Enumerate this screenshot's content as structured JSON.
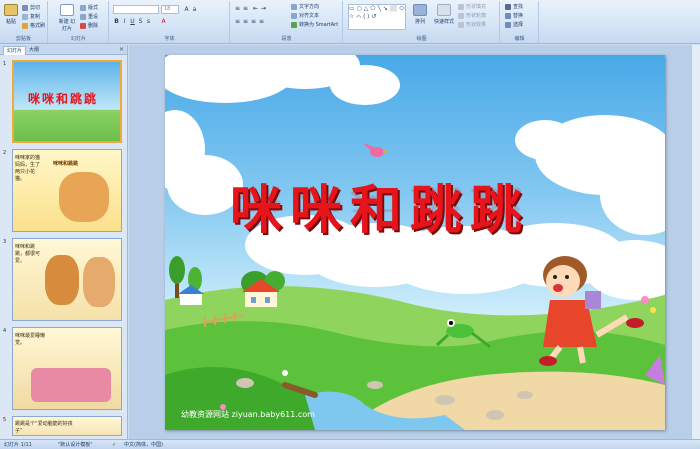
{
  "ribbon": {
    "groups": [
      "剪贴板",
      "幻灯片",
      "字体",
      "段落",
      "绘图",
      "编辑"
    ],
    "clipboard": {
      "paste": "粘贴",
      "cut": "剪切",
      "copy": "复制",
      "format_painter": "格式刷"
    },
    "slides": {
      "new_slide": "新建\n幻灯片",
      "layout": "版式",
      "reset": "重设",
      "delete": "删除"
    },
    "font": {
      "name": "",
      "size": "18"
    },
    "paragraph": {
      "text_direction": "文字方向",
      "align_text": "对齐文本",
      "smartart": "转换为 SmartArt"
    },
    "drawing": {
      "arrange": "排列",
      "quick_styles": "快速样式",
      "shape_fill": "形状填充",
      "shape_outline": "形状轮廓",
      "shape_effects": "形状效果"
    },
    "editing": {
      "find": "查找",
      "replace": "替换",
      "select": "选择"
    }
  },
  "panel": {
    "tabs": [
      "幻灯片",
      "大纲"
    ],
    "thumbnails": [
      {
        "number": "1",
        "title": "咪咪和跳跳"
      },
      {
        "number": "2",
        "text": "咪咪家的猫妈妈，生了两只小花猫。",
        "title": "咪咪和跳跳"
      },
      {
        "number": "3",
        "text": "咪咪和跳跳，都很可爱。"
      },
      {
        "number": "4",
        "text": "咪咪最爱睡懒觉。"
      },
      {
        "number": "5",
        "text": "跳跳是个“爱动脑筋的好孩子”"
      }
    ]
  },
  "slide": {
    "title": "咪咪和跳跳",
    "watermark": "幼教资源网站  ziyuan.baby611.com"
  },
  "status": {
    "slide_count": "幻灯片 1/11",
    "theme": "\"默认设计模板\"",
    "language": "中文(简体，中国)"
  },
  "colors": {
    "title_red": "#e8141c",
    "sky": "#49a9e8",
    "grass": "#5cc23c",
    "selected_border": "#f2a93b"
  }
}
